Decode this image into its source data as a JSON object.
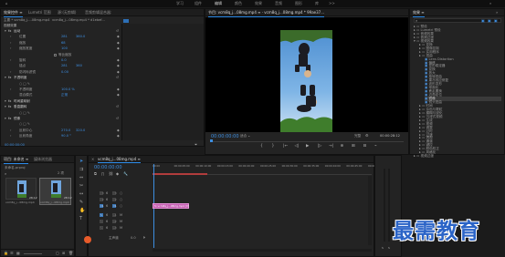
{
  "menu": {
    "items": [
      "学习",
      "组件",
      "编辑",
      "颜色",
      "效果",
      "音频",
      "图形",
      "库",
      ">>"
    ],
    "active": "编辑"
  },
  "effect_controls": {
    "tabs": [
      "效果控件 ≡",
      "Lumetri 范围",
      "源:(无剪辑)",
      "音频剪辑混合器:"
    ],
    "source_clip": "主要 * vcm8q_j....08mg.mp4",
    "sequence_clip": "vcm8q_j...08mg.mp4 * d1ebef...",
    "section_video": "视频效果",
    "rows": [
      {
        "indent": 0,
        "tw": "▾",
        "fx": "fx",
        "label": "运动",
        "reset": "↺"
      },
      {
        "indent": 1,
        "tw": "›",
        "label": "位置",
        "v1": "281",
        "v2": "360.0"
      },
      {
        "indent": 1,
        "tw": "›",
        "label": "缩放",
        "v1": "68"
      },
      {
        "indent": 1,
        "tw": "›",
        "label": "缩放宽度",
        "v1": "100"
      },
      {
        "indent": 1,
        "tw": "",
        "label": "",
        "check": "等比缩放"
      },
      {
        "indent": 1,
        "tw": "›",
        "label": "旋转",
        "v1": "0.0"
      },
      {
        "indent": 1,
        "tw": "",
        "label": "锚点",
        "v1": "281",
        "v2": "360"
      },
      {
        "indent": 1,
        "tw": "›",
        "label": "防闪烁滤镜",
        "v1": "0.00"
      },
      {
        "indent": 0,
        "tw": "▾",
        "fx": "fx",
        "label": "不透明度",
        "reset": "↺"
      },
      {
        "indent": 1,
        "tw": "",
        "label": "○ □ ✎",
        "shapes": true
      },
      {
        "indent": 1,
        "tw": "›",
        "label": "不透明度",
        "v1": "100.0 %"
      },
      {
        "indent": 1,
        "tw": "",
        "label": "混合模式",
        "v1": "正常"
      },
      {
        "indent": 0,
        "tw": "▾",
        "fx": "fx",
        "label": "时间重映射"
      },
      {
        "indent": 0,
        "tw": "▾",
        "fx": "fx",
        "label": "垂直翻转",
        "reset": "↺"
      },
      {
        "indent": 1,
        "tw": "",
        "label": "○ □ ✎",
        "shapes": true
      },
      {
        "indent": 0,
        "tw": "▾",
        "fx": "fx",
        "label": "镜像",
        "reset": "↺"
      },
      {
        "indent": 1,
        "tw": "",
        "label": "○ □ ✎",
        "shapes": true
      },
      {
        "indent": 1,
        "tw": "›",
        "label": "反射中心",
        "v1": "270.0",
        "v2": "320.0"
      },
      {
        "indent": 1,
        "tw": "›",
        "label": "反射角度",
        "v1": "90.0 °"
      }
    ],
    "timecode": "00:00:00:00"
  },
  "program_monitor": {
    "title": "节目: vcm8q_j...08mg.mp4 ≡ · vcm8q_j...08mg.mp4 * 99ae37...",
    "timecode_left": "00:00:00:00",
    "fit_label": "适合",
    "quality": "完整",
    "timecode_right": "00:00:28:12",
    "transport": [
      "{",
      "}",
      "|←",
      "◁|",
      "▶",
      "|▷",
      "→|",
      "⊕",
      "⊞",
      "⊟",
      "⌁"
    ]
  },
  "effects_panel": {
    "title": "效果 ≡",
    "items": [
      {
        "indent": 0,
        "tw": "▸",
        "label": "预设"
      },
      {
        "indent": 0,
        "tw": "▸",
        "label": "Lumetri 预设"
      },
      {
        "indent": 0,
        "tw": "▸",
        "label": "音频效果"
      },
      {
        "indent": 0,
        "tw": "▸",
        "label": "音频过渡"
      },
      {
        "indent": 0,
        "tw": "▾",
        "label": "视频效果"
      },
      {
        "indent": 1,
        "tw": "▸",
        "label": "变换"
      },
      {
        "indent": 1,
        "tw": "▸",
        "label": "图像控制"
      },
      {
        "indent": 1,
        "tw": "▸",
        "label": "实用程序"
      },
      {
        "indent": 1,
        "tw": "▸",
        "label": "扭曲"
      },
      {
        "indent": 2,
        "tw": "",
        "label": "Lens Distortion"
      },
      {
        "indent": 2,
        "tw": "",
        "label": "偏移"
      },
      {
        "indent": 2,
        "tw": "",
        "label": "变形稳定器"
      },
      {
        "indent": 2,
        "tw": "",
        "label": "变换"
      },
      {
        "indent": 2,
        "tw": "",
        "label": "放大"
      },
      {
        "indent": 2,
        "tw": "",
        "label": "旋转扭曲"
      },
      {
        "indent": 2,
        "tw": "",
        "label": "果冻效应修复"
      },
      {
        "indent": 2,
        "tw": "",
        "label": "波形变形"
      },
      {
        "indent": 2,
        "tw": "",
        "label": "球面化"
      },
      {
        "indent": 2,
        "tw": "",
        "label": "紊乱置换"
      },
      {
        "indent": 2,
        "tw": "",
        "label": "边角定位"
      },
      {
        "indent": 2,
        "tw": "",
        "label": "镜像",
        "selected": true
      },
      {
        "indent": 2,
        "tw": "",
        "label": "镜头扭曲"
      },
      {
        "indent": 1,
        "tw": "▸",
        "label": "时间"
      },
      {
        "indent": 1,
        "tw": "▸",
        "label": "杂色与颗粒"
      },
      {
        "indent": 1,
        "tw": "▸",
        "label": "模糊与锐化"
      },
      {
        "indent": 1,
        "tw": "▸",
        "label": "沉浸式视频"
      },
      {
        "indent": 1,
        "tw": "▸",
        "label": "生成"
      },
      {
        "indent": 1,
        "tw": "▸",
        "label": "视频"
      },
      {
        "indent": 1,
        "tw": "▸",
        "label": "调整"
      },
      {
        "indent": 1,
        "tw": "▸",
        "label": "过时"
      },
      {
        "indent": 1,
        "tw": "▸",
        "label": "过渡"
      },
      {
        "indent": 1,
        "tw": "▸",
        "label": "透视"
      },
      {
        "indent": 1,
        "tw": "▸",
        "label": "通道"
      },
      {
        "indent": 1,
        "tw": "▸",
        "label": "键控"
      },
      {
        "indent": 1,
        "tw": "▸",
        "label": "颜色校正"
      },
      {
        "indent": 1,
        "tw": "▸",
        "label": "风格化"
      },
      {
        "indent": 0,
        "tw": "▸",
        "label": "视频过渡"
      }
    ]
  },
  "project_panel": {
    "tabs": [
      "项目: 未命名 ≡",
      "媒体浏览器"
    ],
    "project_name": "未命名.prproj",
    "item_count": "2 项",
    "thumbs": [
      {
        "name": "vcm8q_j...08mg.mp4",
        "duration": "28:12"
      },
      {
        "name": "vcm8q_j...08mg.mp4",
        "duration": "28:12"
      }
    ]
  },
  "timeline": {
    "title": "vcm8q_j...08mg.mp4 ≡",
    "timecode": "00:00:00:00",
    "ruler": [
      "00:00",
      "00:00:05:00",
      "00:00:10:00",
      "00:00:15:00",
      "00:00:20:00",
      "00:00:25:00",
      "00:00:30:00",
      "00:00:35:00",
      "00:00:40:00",
      "00:00:45:00",
      "00:00:50:00"
    ],
    "tracks": [
      {
        "name": "V3",
        "a": "6",
        "b": "○",
        "c": "V3"
      },
      {
        "name": "V2",
        "a": "6",
        "b": "○",
        "c": "V2"
      },
      {
        "name": "V1",
        "a": "6",
        "b": "○",
        "c": "V1"
      },
      {
        "name": "A1",
        "a": "6",
        "b": "M",
        "c": "S"
      },
      {
        "name": "A2",
        "a": "6",
        "b": "M",
        "c": "S"
      },
      {
        "name": "A3",
        "a": "6",
        "b": "M",
        "c": "S"
      }
    ],
    "master": "主声道",
    "master_value": "0.0",
    "clip_label": "fx vcm8q_j...08mg.mp4 [V]"
  },
  "watermark": "最需教育"
}
